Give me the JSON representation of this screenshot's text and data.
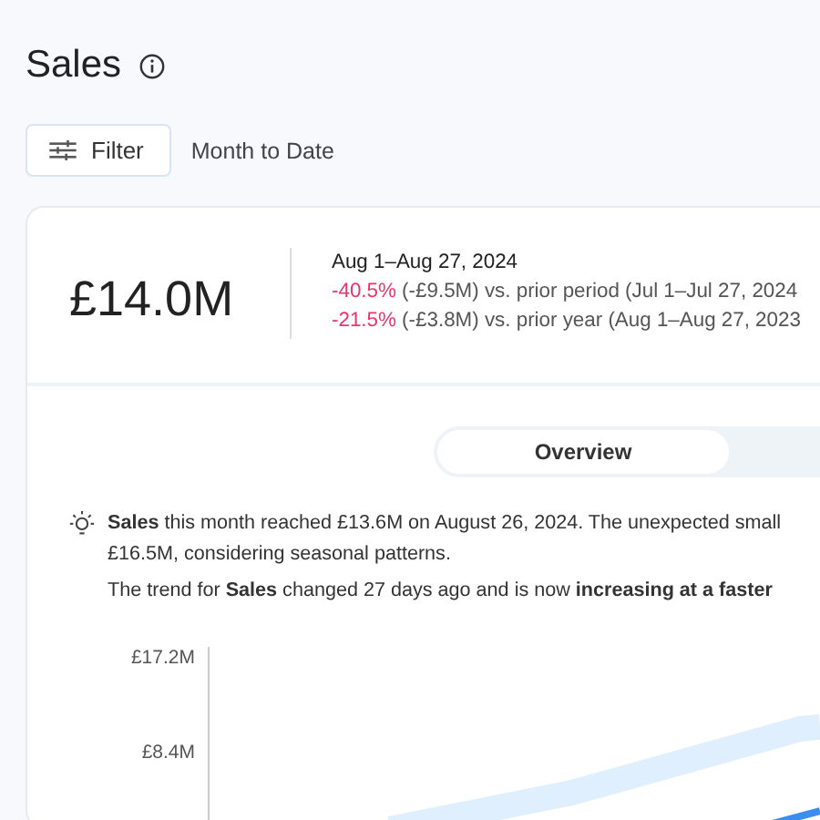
{
  "title": "Sales",
  "toolbar": {
    "filter_label": "Filter",
    "period": "Month to Date"
  },
  "summary": {
    "value": "£14.0M",
    "range": "Aug 1–Aug 27, 2024",
    "comparisons": [
      {
        "change": "-40.5%",
        "rest": "(-£9.5M) vs. prior period (Jul 1–Jul 27, 2024"
      },
      {
        "change": "-21.5%",
        "rest": "(-£3.8M) vs. prior year (Aug 1–Aug 27, 2023"
      }
    ]
  },
  "tabs": [
    {
      "label": "Overview",
      "selected": true
    }
  ],
  "insight": {
    "lines": [
      "**Sales** this month reached £13.6M on August 26, 2024. The unexpected small",
      "£16.5M, considering seasonal patterns."
    ],
    "trend": "The trend for **Sales** changed 27 days ago and is now **increasing at a faster**"
  },
  "chart": {
    "y_ticks": [
      "£17.2M",
      "£8.4M"
    ]
  }
}
